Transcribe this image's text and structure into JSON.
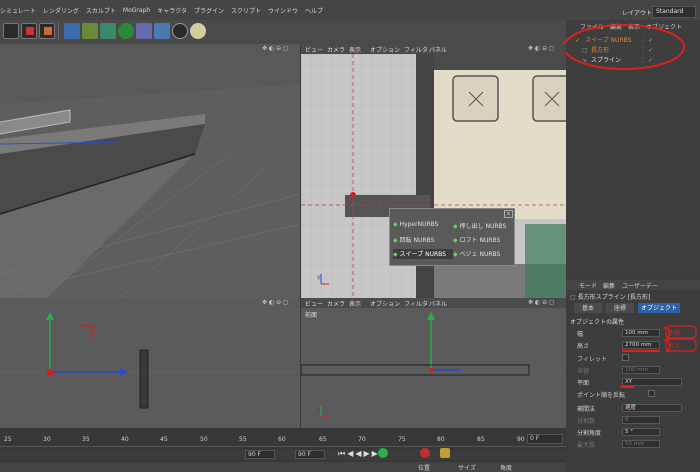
{
  "menu": [
    "シミュレート",
    "レンダリング",
    "スカルプト",
    "MoGraph",
    "キャラクタ",
    "プラグイン",
    "スクリプト",
    "ウインドウ",
    "ヘルプ"
  ],
  "layout": {
    "label": "レイアウト:",
    "value": "Standard"
  },
  "object_manager": {
    "tabs": [
      "ファイル",
      "編集",
      "表示",
      "オブジェクト"
    ],
    "items": [
      {
        "name": "スイープ NURBS"
      },
      {
        "name": "長方形"
      },
      {
        "name": "スプライン"
      }
    ]
  },
  "viewport_menu": [
    "ビュー",
    "カメラ",
    "表示",
    "オプション",
    "フィルタ",
    "パネル"
  ],
  "viewport_labels": {
    "front": "前面"
  },
  "nurbs_popup": [
    [
      "HyperNURBS",
      "押し出し NURBS"
    ],
    [
      "回転 NURBS",
      "ロフト NURBS"
    ],
    [
      "スイープ NURBS",
      "ベジェ NURBS"
    ]
  ],
  "attribute_manager": {
    "menu": [
      "モード",
      "編集",
      "ユーザーデー"
    ],
    "title": "長方形スプライン [長方形]",
    "tabs": [
      "基本",
      "座標",
      "オブジェクト"
    ],
    "section": "オブジェクトの属性",
    "fields": [
      {
        "label": "幅",
        "value": "100 mm",
        "annotation": "手摺",
        "enabled": true
      },
      {
        "label": "高さ",
        "value": "2700 mm",
        "annotation": "長さ",
        "enabled": true
      },
      {
        "label": "フィレット",
        "value": "",
        "enabled": true
      },
      {
        "label": "半径",
        "value": "100 mm",
        "enabled": false
      },
      {
        "label": "平面",
        "value": "XY",
        "enabled": true
      },
      {
        "label": "ポイント順を反転",
        "value": "",
        "enabled": true
      },
      {
        "label": "補間法",
        "value": "適度",
        "enabled": true
      },
      {
        "label": "分割数",
        "value": "8",
        "enabled": false
      },
      {
        "label": "分割角度",
        "value": "5 °",
        "enabled": true
      },
      {
        "label": "最大長",
        "value": "50 mm",
        "enabled": false
      }
    ]
  },
  "timeline": {
    "ticks": [
      "25",
      "30",
      "35",
      "40",
      "45",
      "50",
      "55",
      "60",
      "65",
      "70",
      "75",
      "80",
      "85",
      "90"
    ],
    "frame_a": "0 F",
    "frame_b": "90 F",
    "frame_c": "90 F",
    "labels": [
      "位置",
      "サイズ",
      "角度"
    ]
  },
  "colors": {
    "accent_red": "#e02020",
    "selection_blue": "#3060a8"
  }
}
